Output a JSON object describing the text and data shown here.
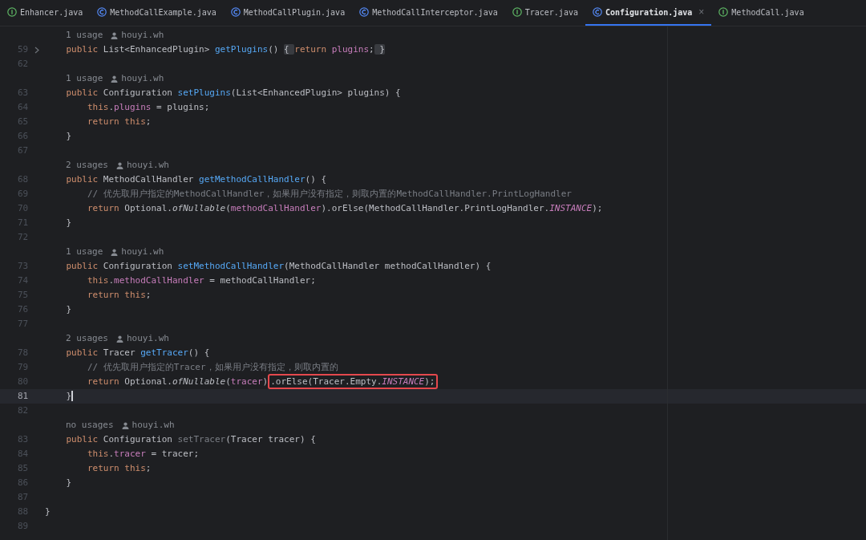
{
  "tabs": [
    {
      "label": "Enhancer.java",
      "kind": "interface",
      "selected": false
    },
    {
      "label": "MethodCallExample.java",
      "kind": "class",
      "selected": false
    },
    {
      "label": "MethodCallPlugin.java",
      "kind": "class",
      "selected": false
    },
    {
      "label": "MethodCallInterceptor.java",
      "kind": "class",
      "selected": false
    },
    {
      "label": "Tracer.java",
      "kind": "interface",
      "selected": false
    },
    {
      "label": "Configuration.java",
      "kind": "class",
      "selected": true,
      "close": "×"
    },
    {
      "label": "MethodCall.java",
      "kind": "interface",
      "selected": false
    }
  ],
  "lines": [
    {
      "kind": "hint",
      "usages": "1 usage",
      "author": "houyi.wh"
    },
    {
      "kind": "code",
      "number": "59",
      "folded": true,
      "current": false,
      "tokens": [
        {
          "t": "    public ",
          "kind": "kw"
        },
        {
          "t": "List<EnhancedPlugin> ",
          "kind": "plain"
        },
        {
          "t": "getPlugins",
          "kind": "fn"
        },
        {
          "t": "() ",
          "kind": "plain"
        },
        {
          "t": "{ ",
          "kind": "fold"
        },
        {
          "t": "return ",
          "kind": "kw"
        },
        {
          "t": "plugins",
          "kind": "field"
        },
        {
          "t": ";",
          "kind": "plain"
        },
        {
          "t": " }",
          "kind": "fold"
        }
      ]
    },
    {
      "kind": "code",
      "number": "62",
      "folded": false,
      "current": false
    },
    {
      "kind": "hint",
      "usages": "1 usage",
      "author": "houyi.wh"
    },
    {
      "kind": "code",
      "number": "63",
      "folded": false,
      "current": false,
      "tokens": [
        {
          "t": "    public ",
          "kind": "kw"
        },
        {
          "t": "Configuration ",
          "kind": "plain"
        },
        {
          "t": "setPlugins",
          "kind": "fn"
        },
        {
          "t": "(List<EnhancedPlugin> plugins) {",
          "kind": "plain"
        }
      ]
    },
    {
      "kind": "code",
      "number": "64",
      "folded": false,
      "current": false,
      "tokens": [
        {
          "t": "        this",
          "kind": "kw"
        },
        {
          "t": ".",
          "kind": "plain"
        },
        {
          "t": "plugins",
          "kind": "field"
        },
        {
          "t": " = plugins;",
          "kind": "plain"
        }
      ]
    },
    {
      "kind": "code",
      "number": "65",
      "folded": false,
      "current": false,
      "tokens": [
        {
          "t": "        return this",
          "kind": "kw"
        },
        {
          "t": ";",
          "kind": "plain"
        }
      ]
    },
    {
      "kind": "code",
      "number": "66",
      "folded": false,
      "current": false,
      "tokens": [
        {
          "t": "    }",
          "kind": "plain"
        }
      ]
    },
    {
      "kind": "code",
      "number": "67",
      "folded": false,
      "current": false
    },
    {
      "kind": "hint",
      "usages": "2 usages",
      "author": "houyi.wh"
    },
    {
      "kind": "code",
      "number": "68",
      "folded": false,
      "current": false,
      "tokens": [
        {
          "t": "    public ",
          "kind": "kw"
        },
        {
          "t": "MethodCallHandler ",
          "kind": "plain"
        },
        {
          "t": "getMethodCallHandler",
          "kind": "fn"
        },
        {
          "t": "() {",
          "kind": "plain"
        }
      ]
    },
    {
      "kind": "code",
      "number": "69",
      "folded": false,
      "current": false,
      "tokens": [
        {
          "t": "        // 优先取用户指定的MethodCallHandler，如果用户没有指定，则取内置的MethodCallHandler.PrintLogHandler",
          "kind": "comment"
        }
      ]
    },
    {
      "kind": "code",
      "number": "70",
      "folded": false,
      "current": false,
      "tokens": [
        {
          "t": "        return ",
          "kind": "kw"
        },
        {
          "t": "Optional.",
          "kind": "plain"
        },
        {
          "t": "ofNullable",
          "kind": "italic"
        },
        {
          "t": "(",
          "kind": "plain"
        },
        {
          "t": "methodCallHandler",
          "kind": "field"
        },
        {
          "t": ").orElse(MethodCallHandler.PrintLogHandler.",
          "kind": "plain"
        },
        {
          "t": "INSTANCE",
          "kind": "static"
        },
        {
          "t": ");",
          "kind": "plain"
        }
      ]
    },
    {
      "kind": "code",
      "number": "71",
      "folded": false,
      "current": false,
      "tokens": [
        {
          "t": "    }",
          "kind": "plain"
        }
      ]
    },
    {
      "kind": "code",
      "number": "72",
      "folded": false,
      "current": false
    },
    {
      "kind": "hint",
      "usages": "1 usage",
      "author": "houyi.wh"
    },
    {
      "kind": "code",
      "number": "73",
      "folded": false,
      "current": false,
      "tokens": [
        {
          "t": "    public ",
          "kind": "kw"
        },
        {
          "t": "Configuration ",
          "kind": "plain"
        },
        {
          "t": "setMethodCallHandler",
          "kind": "fn"
        },
        {
          "t": "(MethodCallHandler methodCallHandler) {",
          "kind": "plain"
        }
      ]
    },
    {
      "kind": "code",
      "number": "74",
      "folded": false,
      "current": false,
      "tokens": [
        {
          "t": "        this",
          "kind": "kw"
        },
        {
          "t": ".",
          "kind": "plain"
        },
        {
          "t": "methodCallHandler",
          "kind": "field"
        },
        {
          "t": " = methodCallHandler;",
          "kind": "plain"
        }
      ]
    },
    {
      "kind": "code",
      "number": "75",
      "folded": false,
      "current": false,
      "tokens": [
        {
          "t": "        return this",
          "kind": "kw"
        },
        {
          "t": ";",
          "kind": "plain"
        }
      ]
    },
    {
      "kind": "code",
      "number": "76",
      "folded": false,
      "current": false,
      "tokens": [
        {
          "t": "    }",
          "kind": "plain"
        }
      ]
    },
    {
      "kind": "code",
      "number": "77",
      "folded": false,
      "current": false
    },
    {
      "kind": "hint",
      "usages": "2 usages",
      "author": "houyi.wh"
    },
    {
      "kind": "code",
      "number": "78",
      "folded": false,
      "current": false,
      "tokens": [
        {
          "t": "    public ",
          "kind": "kw"
        },
        {
          "t": "Tracer ",
          "kind": "plain"
        },
        {
          "t": "getTracer",
          "kind": "fn"
        },
        {
          "t": "() {",
          "kind": "plain"
        }
      ]
    },
    {
      "kind": "code",
      "number": "79",
      "folded": false,
      "current": false,
      "tokens": [
        {
          "t": "        // 优先取用户指定的Tracer，如果用户没有指定，则取内置的",
          "kind": "comment"
        }
      ]
    },
    {
      "kind": "code",
      "number": "80",
      "folded": false,
      "current": false,
      "tokens": [
        {
          "t": "        return ",
          "kind": "kw"
        },
        {
          "t": "Optional.",
          "kind": "plain"
        },
        {
          "t": "ofNullable",
          "kind": "italic"
        },
        {
          "t": "(",
          "kind": "plain"
        },
        {
          "t": "tracer",
          "kind": "field"
        },
        {
          "t": ")",
          "kind": "plain"
        },
        {
          "t": ".orElse(Tracer.Empty.",
          "kind": "plain",
          "boxed": true
        },
        {
          "t": "INSTANCE",
          "kind": "static",
          "boxed": true
        },
        {
          "t": ");",
          "kind": "plain",
          "boxed": true
        }
      ]
    },
    {
      "kind": "code",
      "number": "81",
      "folded": false,
      "current": true,
      "tokens": [
        {
          "t": "    }",
          "kind": "plain"
        }
      ]
    },
    {
      "kind": "code",
      "number": "82",
      "folded": false,
      "current": false
    },
    {
      "kind": "hint",
      "usages": "no usages",
      "author": "houyi.wh"
    },
    {
      "kind": "code",
      "number": "83",
      "folded": false,
      "current": false,
      "tokens": [
        {
          "t": "    public ",
          "kind": "kw"
        },
        {
          "t": "Configuration ",
          "kind": "plain"
        },
        {
          "t": "setTracer",
          "kind": "unused"
        },
        {
          "t": "(Tracer tracer) {",
          "kind": "plain"
        }
      ]
    },
    {
      "kind": "code",
      "number": "84",
      "folded": false,
      "current": false,
      "tokens": [
        {
          "t": "        this",
          "kind": "kw"
        },
        {
          "t": ".",
          "kind": "plain"
        },
        {
          "t": "tracer",
          "kind": "field"
        },
        {
          "t": " = tracer;",
          "kind": "plain"
        }
      ]
    },
    {
      "kind": "code",
      "number": "85",
      "folded": false,
      "current": false,
      "tokens": [
        {
          "t": "        return this",
          "kind": "kw"
        },
        {
          "t": ";",
          "kind": "plain"
        }
      ]
    },
    {
      "kind": "code",
      "number": "86",
      "folded": false,
      "current": false,
      "tokens": [
        {
          "t": "    }",
          "kind": "plain"
        }
      ]
    },
    {
      "kind": "code",
      "number": "87",
      "folded": false,
      "current": false
    },
    {
      "kind": "code",
      "number": "88",
      "folded": false,
      "current": false,
      "tokens": [
        {
          "t": "}",
          "kind": "plain"
        }
      ]
    },
    {
      "kind": "code",
      "number": "89",
      "folded": false,
      "current": false
    }
  ]
}
